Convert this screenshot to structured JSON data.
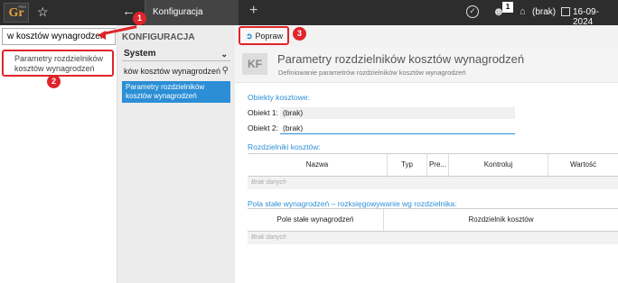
{
  "topbar": {
    "logo": "Gr",
    "logo_sup": "PRO",
    "tab_label": "Konfiguracja systemu",
    "user_badge": "1",
    "user_context": "(brak)",
    "date": "16-09-2024"
  },
  "search": {
    "value": "w kosztów wynagrodzeń",
    "result": "Parametry rozdzielników kosztów wynagrodzeń"
  },
  "config": {
    "title": "KONFIGURACJA",
    "select_value": "System",
    "filter_value": "ków kosztów wynagrodzeń",
    "item": "Parametry rozdzielników kosztów wynagrodzeń"
  },
  "toolbar": {
    "edit_label": "Popraw"
  },
  "header": {
    "icon_text": "KF",
    "title": "Parametry rozdzielników kosztów wynagrodzeń",
    "subtitle": "Definiowanie parametrów rozdzielników kosztów wynagrodzeń"
  },
  "cost_objects": {
    "label": "Obiekty kosztowe:",
    "obj1_label": "Obiekt 1:",
    "obj1_value": "(brak)",
    "obj2_label": "Obiekt 2:",
    "obj2_value": "(brak)"
  },
  "distributors": {
    "label": "Rozdzielniki kosztów:",
    "columns": [
      "Nazwa",
      "Typ",
      "Pre...",
      "Kontroluj",
      "Wartość"
    ],
    "empty": "Brak danych"
  },
  "fixed_fields": {
    "label": "Pola stałe wynagrodzeń – rozksięgowywanie wg rozdzielnika:",
    "columns": [
      "Pole stałe wynagrodzeń",
      "Rozdzielnik kosztów"
    ],
    "empty": "Brak danych"
  },
  "annotations": [
    "1",
    "2",
    "3"
  ],
  "colors": {
    "accent": "#2c8fd6",
    "annotation_red": "#e0242b",
    "topbar": "#2d2d2d"
  }
}
